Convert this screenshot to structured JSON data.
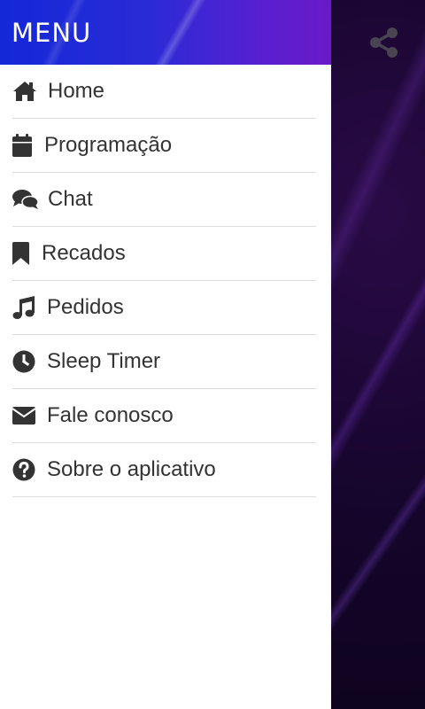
{
  "drawer": {
    "title": "MENU",
    "header_gradient": [
      "#1428d8",
      "#6a1ac8"
    ],
    "items": [
      {
        "label": "Home",
        "icon": "home-icon"
      },
      {
        "label": "Programação",
        "icon": "calendar-icon"
      },
      {
        "label": "Chat",
        "icon": "chat-bubbles-icon"
      },
      {
        "label": "Recados",
        "icon": "bookmark-icon"
      },
      {
        "label": "Pedidos",
        "icon": "music-note-icon"
      },
      {
        "label": "Sleep Timer",
        "icon": "clock-icon"
      },
      {
        "label": "Fale conosco",
        "icon": "envelope-icon"
      },
      {
        "label": "Sobre o aplicativo",
        "icon": "question-circle-icon"
      }
    ]
  },
  "app": {
    "share_icon": "share-icon",
    "background_color": "#0c0318"
  }
}
